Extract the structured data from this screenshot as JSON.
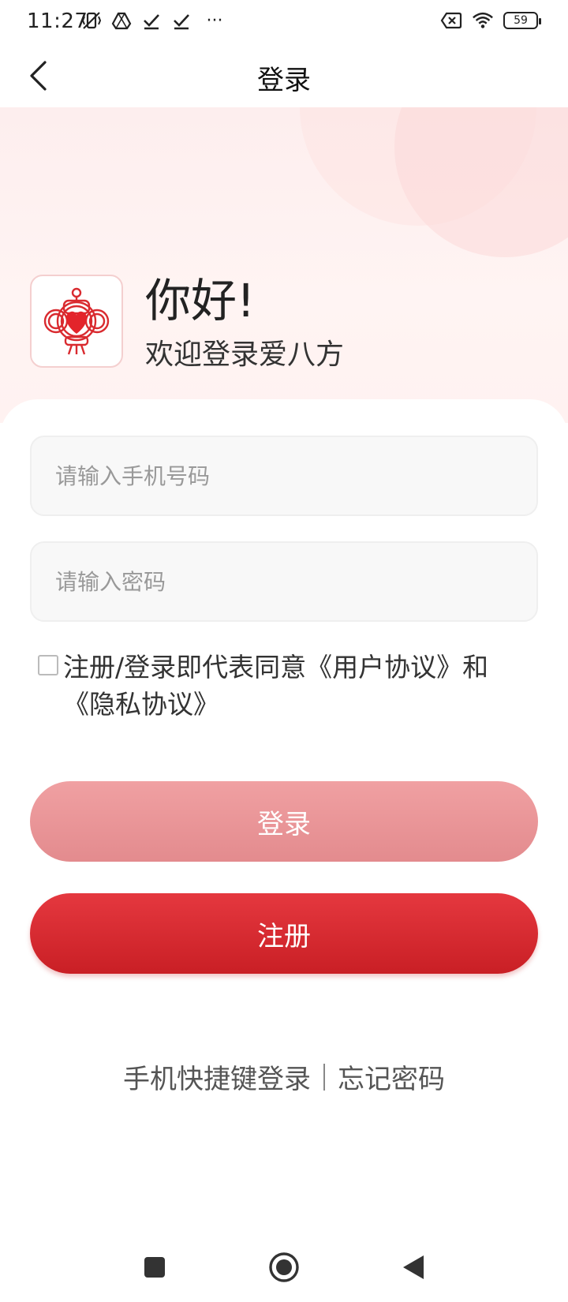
{
  "status_bar": {
    "time": "11:27",
    "battery": "59",
    "more": "···"
  },
  "nav": {
    "title": "登录"
  },
  "hero": {
    "greeting": "你好!",
    "welcome": "欢迎登录爱八方"
  },
  "form": {
    "phone_placeholder": "请输入手机号码",
    "password_placeholder": "请输入密码",
    "agree_prefix": "注册/登录即代表同意",
    "user_agreement": "《用户协议》",
    "agree_and": "和",
    "privacy_policy": "《隐私协议》",
    "agreed": false
  },
  "buttons": {
    "login": "登录",
    "register": "注册"
  },
  "links": {
    "quick_login": "手机快捷键登录",
    "forgot_password": "忘记密码"
  },
  "colors": {
    "register_red": "#d42a30",
    "login_disabled_pink": "#eb9597",
    "hero_bg": "#fdeeee"
  }
}
